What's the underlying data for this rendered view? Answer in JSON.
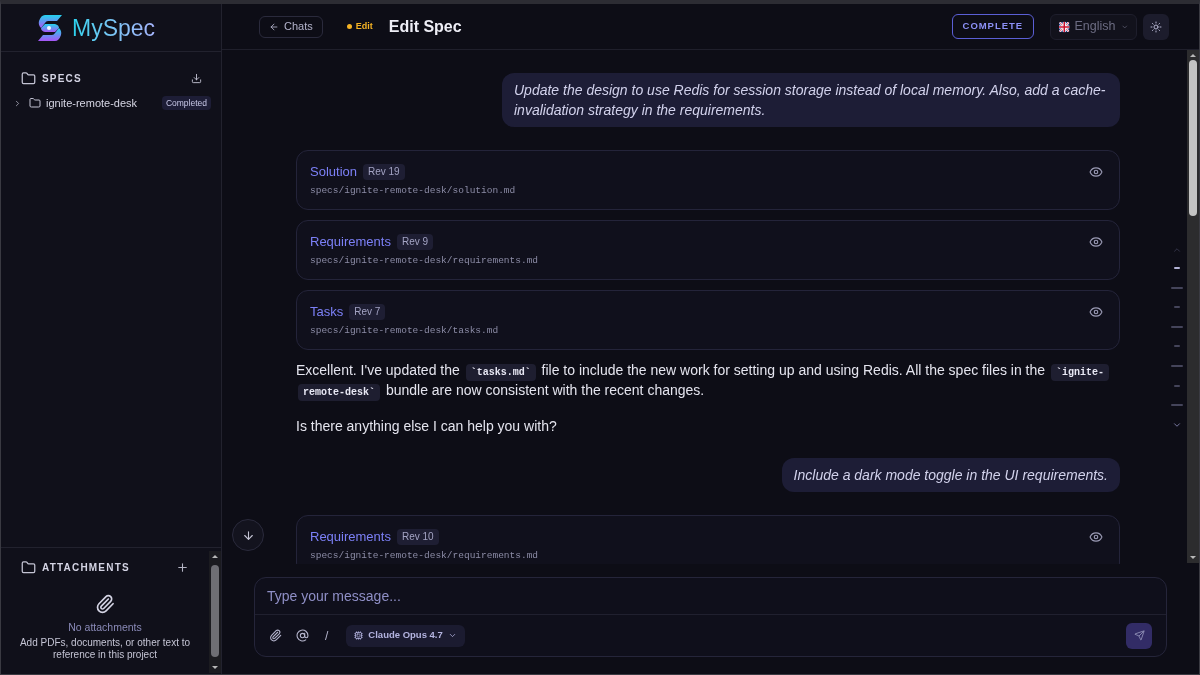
{
  "sidebar": {
    "logo": "MySpec",
    "specs": {
      "title": "SPECS",
      "items": [
        {
          "name": "ignite-remote-desk",
          "badge": "Completed",
          "expanded": false
        }
      ]
    },
    "attachments": {
      "title": "ATTACHMENTS",
      "empty_title": "No attachments",
      "empty_text": "Add PDFs, documents, or other text to reference in this project"
    }
  },
  "header": {
    "back_button": "Chats",
    "mode": "Edit",
    "title": "Edit Spec",
    "complete_button": "COMPLETE",
    "language": "English"
  },
  "messages": [
    {
      "kind": "user",
      "text": "Update the design to use Redis for session storage instead of local memory. Also, add a cache-invalidation strategy in the requirements."
    },
    {
      "kind": "file",
      "title": "Solution",
      "rev": "Rev 19",
      "path": "specs/ignite-remote-desk/solution.md"
    },
    {
      "kind": "file",
      "title": "Requirements",
      "rev": "Rev 9",
      "path": "specs/ignite-remote-desk/requirements.md"
    },
    {
      "kind": "file",
      "title": "Tasks",
      "rev": "Rev 7",
      "path": "specs/ignite-remote-desk/tasks.md"
    },
    {
      "kind": "assistant",
      "segments": [
        {
          "kind": "text",
          "text": "Excellent. I've updated the "
        },
        {
          "kind": "code",
          "text": "`tasks.md`"
        },
        {
          "kind": "text",
          "text": " file to include the new work for setting up and using Redis. All the spec files in the "
        },
        {
          "kind": "code",
          "text": "`ignite-remote-desk`"
        },
        {
          "kind": "text",
          "text": " bundle are now consistent with the recent changes."
        }
      ]
    },
    {
      "kind": "assistant",
      "segments": [
        {
          "kind": "text",
          "text": "Is there anything else I can help you with?"
        }
      ]
    },
    {
      "kind": "user",
      "text": "Include a dark mode toggle in the UI requirements."
    },
    {
      "kind": "file",
      "title": "Requirements",
      "rev": "Rev 10",
      "path": "specs/ignite-remote-desk/requirements.md"
    }
  ],
  "outline": [
    {
      "kind": "short",
      "selected": true
    },
    {
      "kind": "long",
      "selected": false
    },
    {
      "kind": "short",
      "selected": false
    },
    {
      "kind": "long",
      "selected": false
    },
    {
      "kind": "short",
      "selected": false
    },
    {
      "kind": "long",
      "selected": false
    },
    {
      "kind": "short",
      "selected": false
    },
    {
      "kind": "long",
      "selected": false
    }
  ],
  "composer": {
    "placeholder": "Type your message...",
    "command_key": "/",
    "model": "Claude Opus 4.7"
  }
}
